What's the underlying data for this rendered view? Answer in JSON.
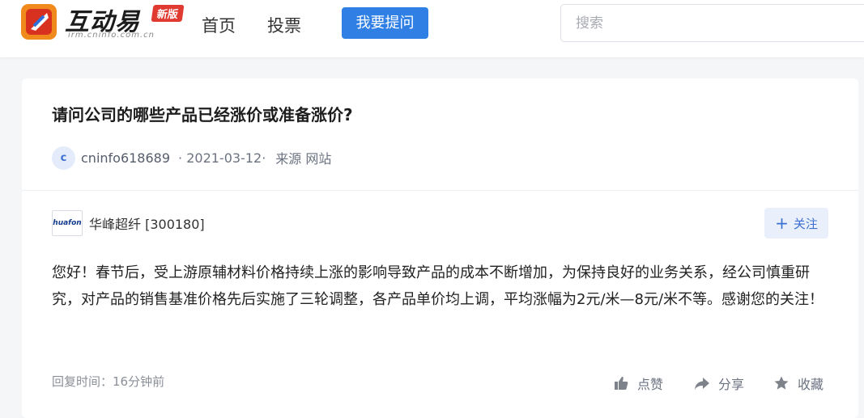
{
  "header": {
    "logo_name": "互动易",
    "logo_badge": "新版",
    "logo_url": "irm.cninfo.com.cn",
    "nav": {
      "home": "首页",
      "vote": "投票"
    },
    "ask_button": "我要提问",
    "search_placeholder": "搜索"
  },
  "question": {
    "title": "请问公司的哪些产品已经涨价或准备涨价?",
    "avatar_letter": "c",
    "user": "cninfo618689",
    "date": "· 2021-03-12·",
    "source": "来源 网站"
  },
  "answer": {
    "company_logo_text": "huafon",
    "company": "华峰超纤 [300180]",
    "follow_label": "关注",
    "text": "您好！春节后，受上游原辅材料价格持续上涨的影响导致产品的成本不断增加，为保持良好的业务关系，经公司慎重研究，对产品的销售基准价格先后实施了三轮调整，各产品单价均上调，平均涨幅为2元/米—8元/米不等。感谢您的关注！",
    "reply_time": "回复时间：16分钟前",
    "actions": {
      "like": "点赞",
      "share": "分享",
      "favorite": "收藏"
    }
  },
  "colors": {
    "accent": "#2f7fe4",
    "badge": "#e03b31",
    "follow_bg": "#e9f0fb"
  }
}
